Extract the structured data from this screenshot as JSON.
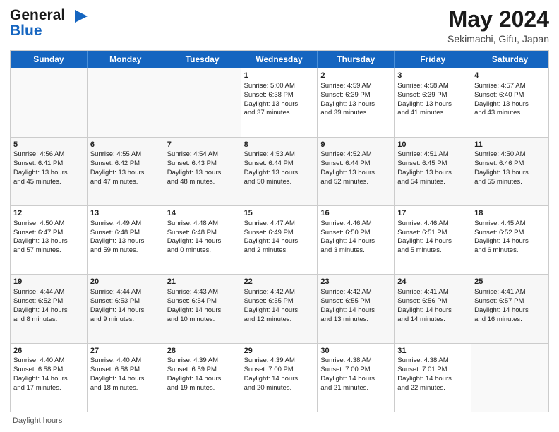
{
  "logo": {
    "line1": "General",
    "line2": "Blue"
  },
  "title": "May 2024",
  "subtitle": "Sekimachi, Gifu, Japan",
  "days": [
    "Sunday",
    "Monday",
    "Tuesday",
    "Wednesday",
    "Thursday",
    "Friday",
    "Saturday"
  ],
  "footer": "Daylight hours",
  "weeks": [
    [
      {
        "day": "",
        "info": ""
      },
      {
        "day": "",
        "info": ""
      },
      {
        "day": "",
        "info": ""
      },
      {
        "day": "1",
        "info": "Sunrise: 5:00 AM\nSunset: 6:38 PM\nDaylight: 13 hours\nand 37 minutes."
      },
      {
        "day": "2",
        "info": "Sunrise: 4:59 AM\nSunset: 6:39 PM\nDaylight: 13 hours\nand 39 minutes."
      },
      {
        "day": "3",
        "info": "Sunrise: 4:58 AM\nSunset: 6:39 PM\nDaylight: 13 hours\nand 41 minutes."
      },
      {
        "day": "4",
        "info": "Sunrise: 4:57 AM\nSunset: 6:40 PM\nDaylight: 13 hours\nand 43 minutes."
      }
    ],
    [
      {
        "day": "5",
        "info": "Sunrise: 4:56 AM\nSunset: 6:41 PM\nDaylight: 13 hours\nand 45 minutes."
      },
      {
        "day": "6",
        "info": "Sunrise: 4:55 AM\nSunset: 6:42 PM\nDaylight: 13 hours\nand 47 minutes."
      },
      {
        "day": "7",
        "info": "Sunrise: 4:54 AM\nSunset: 6:43 PM\nDaylight: 13 hours\nand 48 minutes."
      },
      {
        "day": "8",
        "info": "Sunrise: 4:53 AM\nSunset: 6:44 PM\nDaylight: 13 hours\nand 50 minutes."
      },
      {
        "day": "9",
        "info": "Sunrise: 4:52 AM\nSunset: 6:44 PM\nDaylight: 13 hours\nand 52 minutes."
      },
      {
        "day": "10",
        "info": "Sunrise: 4:51 AM\nSunset: 6:45 PM\nDaylight: 13 hours\nand 54 minutes."
      },
      {
        "day": "11",
        "info": "Sunrise: 4:50 AM\nSunset: 6:46 PM\nDaylight: 13 hours\nand 55 minutes."
      }
    ],
    [
      {
        "day": "12",
        "info": "Sunrise: 4:50 AM\nSunset: 6:47 PM\nDaylight: 13 hours\nand 57 minutes."
      },
      {
        "day": "13",
        "info": "Sunrise: 4:49 AM\nSunset: 6:48 PM\nDaylight: 13 hours\nand 59 minutes."
      },
      {
        "day": "14",
        "info": "Sunrise: 4:48 AM\nSunset: 6:48 PM\nDaylight: 14 hours\nand 0 minutes."
      },
      {
        "day": "15",
        "info": "Sunrise: 4:47 AM\nSunset: 6:49 PM\nDaylight: 14 hours\nand 2 minutes."
      },
      {
        "day": "16",
        "info": "Sunrise: 4:46 AM\nSunset: 6:50 PM\nDaylight: 14 hours\nand 3 minutes."
      },
      {
        "day": "17",
        "info": "Sunrise: 4:46 AM\nSunset: 6:51 PM\nDaylight: 14 hours\nand 5 minutes."
      },
      {
        "day": "18",
        "info": "Sunrise: 4:45 AM\nSunset: 6:52 PM\nDaylight: 14 hours\nand 6 minutes."
      }
    ],
    [
      {
        "day": "19",
        "info": "Sunrise: 4:44 AM\nSunset: 6:52 PM\nDaylight: 14 hours\nand 8 minutes."
      },
      {
        "day": "20",
        "info": "Sunrise: 4:44 AM\nSunset: 6:53 PM\nDaylight: 14 hours\nand 9 minutes."
      },
      {
        "day": "21",
        "info": "Sunrise: 4:43 AM\nSunset: 6:54 PM\nDaylight: 14 hours\nand 10 minutes."
      },
      {
        "day": "22",
        "info": "Sunrise: 4:42 AM\nSunset: 6:55 PM\nDaylight: 14 hours\nand 12 minutes."
      },
      {
        "day": "23",
        "info": "Sunrise: 4:42 AM\nSunset: 6:55 PM\nDaylight: 14 hours\nand 13 minutes."
      },
      {
        "day": "24",
        "info": "Sunrise: 4:41 AM\nSunset: 6:56 PM\nDaylight: 14 hours\nand 14 minutes."
      },
      {
        "day": "25",
        "info": "Sunrise: 4:41 AM\nSunset: 6:57 PM\nDaylight: 14 hours\nand 16 minutes."
      }
    ],
    [
      {
        "day": "26",
        "info": "Sunrise: 4:40 AM\nSunset: 6:58 PM\nDaylight: 14 hours\nand 17 minutes."
      },
      {
        "day": "27",
        "info": "Sunrise: 4:40 AM\nSunset: 6:58 PM\nDaylight: 14 hours\nand 18 minutes."
      },
      {
        "day": "28",
        "info": "Sunrise: 4:39 AM\nSunset: 6:59 PM\nDaylight: 14 hours\nand 19 minutes."
      },
      {
        "day": "29",
        "info": "Sunrise: 4:39 AM\nSunset: 7:00 PM\nDaylight: 14 hours\nand 20 minutes."
      },
      {
        "day": "30",
        "info": "Sunrise: 4:38 AM\nSunset: 7:00 PM\nDaylight: 14 hours\nand 21 minutes."
      },
      {
        "day": "31",
        "info": "Sunrise: 4:38 AM\nSunset: 7:01 PM\nDaylight: 14 hours\nand 22 minutes."
      },
      {
        "day": "",
        "info": ""
      }
    ]
  ]
}
